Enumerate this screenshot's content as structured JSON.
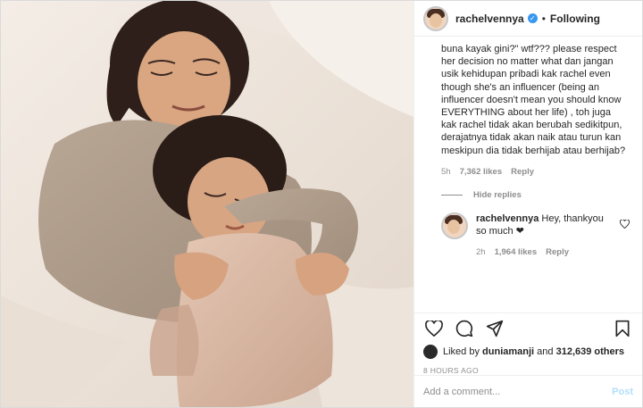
{
  "post": {
    "username": "rachelvennya",
    "verified_mark": "✓",
    "separator": "•",
    "follow_status": "Following"
  },
  "comment": {
    "text": "buna kayak gini?\" wtf??? please respect her decision no matter what dan jangan usik kehidupan pribadi kak rachel even though she's an influencer (being an influencer doesn't mean you should know EVERYTHING about her life) , toh juga kak rachel tidak akan berubah sedikitpun, derajatnya tidak akan naik atau turun kan meskipun dia tidak berhijab atau berhijab?",
    "time": "5h",
    "likes": "7,362 likes",
    "reply_label": "Reply",
    "hide_replies": "Hide replies"
  },
  "reply": {
    "username": "rachelvennya",
    "text": "Hey, thankyou so much ❤",
    "time": "2h",
    "likes": "1,964 likes",
    "reply_label": "Reply"
  },
  "likes_line": {
    "prefix": "Liked by",
    "user": "duniamanji",
    "and": "and",
    "count": "312,639 others"
  },
  "timestamp": "8 HOURS AGO",
  "add_comment": {
    "placeholder": "Add a comment...",
    "post_label": "Post"
  },
  "icons": {
    "like": "heart-icon",
    "comment": "comment-icon",
    "share": "share-icon",
    "save": "bookmark-icon",
    "comment_like": "heart-outline-icon"
  },
  "colors": {
    "verified": "#3897f0",
    "post_button": "#b2dffc",
    "muted": "#8e8e8e"
  }
}
